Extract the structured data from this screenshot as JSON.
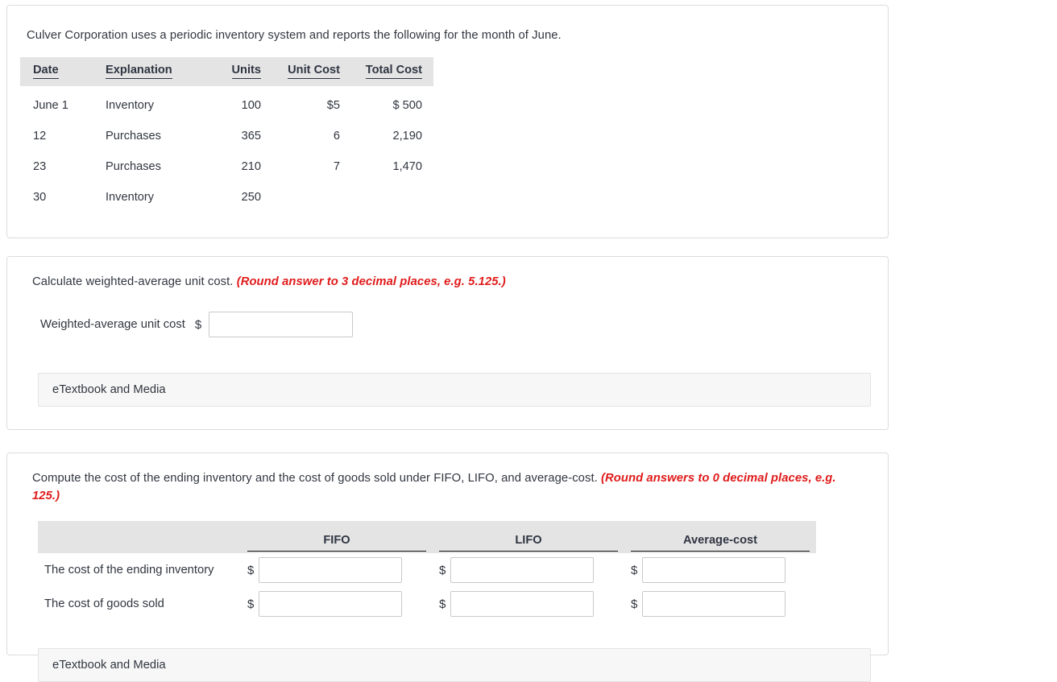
{
  "inventory_card": {
    "intro": "Culver Corporation uses a periodic inventory system and reports the following for the month of June.",
    "table": {
      "columns": [
        "Date",
        "Explanation",
        "Units",
        "Unit Cost",
        "Total Cost"
      ],
      "rows": [
        {
          "date": "June 1",
          "explanation": "Inventory",
          "units": "100",
          "unit_cost": "$5",
          "total_cost": "$ 500"
        },
        {
          "date": "12",
          "explanation": "Purchases",
          "units": "365",
          "unit_cost": "6",
          "total_cost": "2,190"
        },
        {
          "date": "23",
          "explanation": "Purchases",
          "units": "210",
          "unit_cost": "7",
          "total_cost": "1,470"
        },
        {
          "date": "30",
          "explanation": "Inventory",
          "units": "250",
          "unit_cost": "",
          "total_cost": ""
        }
      ]
    }
  },
  "weighted_card": {
    "prompt_main": "Calculate weighted-average unit cost.",
    "prompt_hint": "(Round answer to 3 decimal places, e.g. 5.125.)",
    "row_label": "Weighted-average unit cost",
    "currency_symbol": "$",
    "input_value": "",
    "etextbook_label": "eTextbook and Media"
  },
  "compute_card": {
    "prompt_main": "Compute the cost of the ending inventory and the cost of goods sold under FIFO, LIFO, and average-cost.",
    "prompt_hint": "(Round answers to 0 decimal places, e.g. 125.)",
    "table": {
      "columns": [
        "",
        "FIFO",
        "LIFO",
        "Average-cost"
      ],
      "rows": [
        {
          "label": "The cost of the ending inventory",
          "cells": [
            {
              "currency_symbol": "$",
              "value": ""
            },
            {
              "currency_symbol": "$",
              "value": ""
            },
            {
              "currency_symbol": "$",
              "value": ""
            }
          ]
        },
        {
          "label": "The cost of goods sold",
          "cells": [
            {
              "currency_symbol": "$",
              "value": ""
            },
            {
              "currency_symbol": "$",
              "value": ""
            },
            {
              "currency_symbol": "$",
              "value": ""
            }
          ]
        }
      ]
    },
    "etextbook_label": "eTextbook and Media"
  },
  "colors": {
    "text": "#31363f",
    "hint_red": "#e01b1b",
    "table_header_bg": "#e4e4e4",
    "card_border": "#dcdcdc",
    "etextbook_bg": "#f7f7f7"
  }
}
